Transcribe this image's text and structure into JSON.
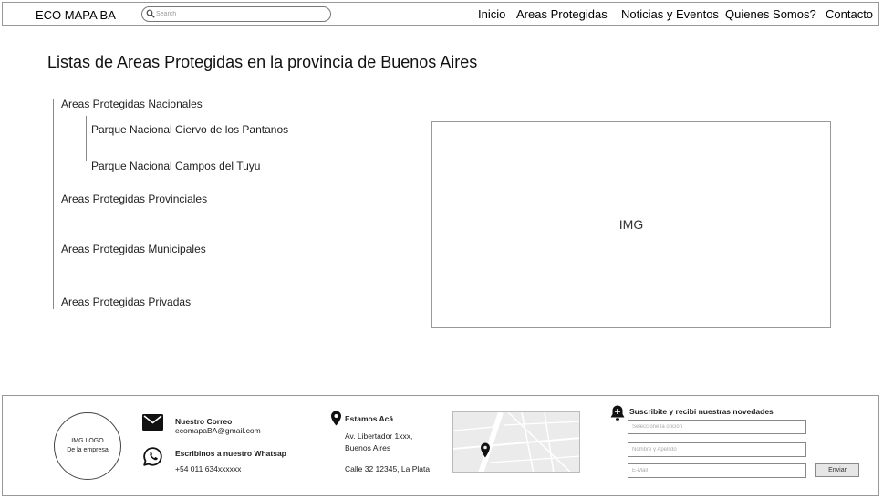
{
  "header": {
    "brand": "ECO MAPA BA",
    "search_placeholder": "Search",
    "nav": [
      "Inicio",
      "Areas Protegidas",
      "Noticias y Eventos",
      "Quienes Somos?",
      "Contacto"
    ]
  },
  "main": {
    "title": "Listas de Areas Protegidas en la provincia de Buenos Aires",
    "tree": {
      "nacionales": "Areas Protegidas Nacionales",
      "nacionales_children": [
        "Parque Nacional Ciervo de los Pantanos",
        "Parque Nacional Campos del Tuyu"
      ],
      "provinciales": "Areas Protegidas Provinciales",
      "municipales": "Areas Protegidas Municipales",
      "privadas": "Areas Protegidas Privadas"
    },
    "image_placeholder": "IMG"
  },
  "footer": {
    "logo_line1": "IMG LOGO",
    "logo_line2": "De la empresa",
    "mail_title": "Nuestro Correo",
    "mail_value": "ecomapaBA@gmail.com",
    "whatsapp_title": "Escribinos a nuestro Whatsap",
    "whatsapp_value": "+54 011 634xxxxxx",
    "location_title": "Estamos Acá",
    "address_line1": "Av. Libertador 1xxx,",
    "address_line2": "Buenos Aires",
    "address_line3": "Calle 32 12345, La Plata",
    "subscribe_title": "Suscribite y recibi nuestras novedades",
    "select_placeholder": "Seleccione la opción",
    "name_placeholder": "Nombre y Apellido",
    "email_placeholder": "E-Mail",
    "send_label": "Enviar"
  },
  "icons": {
    "search": "search-icon",
    "mail": "mail-icon",
    "whatsapp": "whatsapp-icon",
    "location": "location-pin-icon",
    "bell": "bell-plus-icon"
  }
}
